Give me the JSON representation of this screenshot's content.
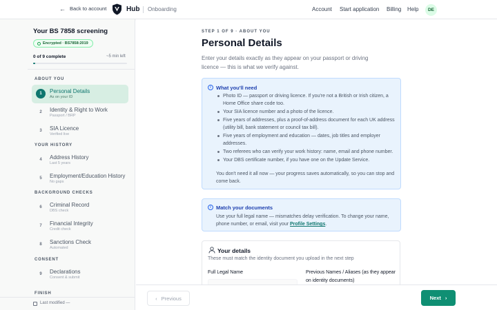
{
  "topbar": {
    "back_label": "Back to account",
    "brand": "Hub",
    "context": "Onboarding",
    "nav": [
      "Account",
      "Start application",
      "Billing",
      "Help"
    ],
    "avatar_initials": "DE"
  },
  "sidebar": {
    "title": "Your BS 7858 screening",
    "badge": "Encrypted · BS7858:2019",
    "progress_label": "0 of 9 complete",
    "progress_fraction": 0.02,
    "time_left": "~5 min left",
    "sections": [
      {
        "heading": "ABOUT YOU",
        "steps": [
          {
            "num": "1",
            "name": "Personal Details",
            "sub": "As on your ID",
            "active": true
          },
          {
            "num": "2",
            "name": "Identity & Right to Work",
            "sub": "Passport / BRP"
          },
          {
            "num": "3",
            "name": "SIA Licence",
            "sub": "Verified live"
          }
        ]
      },
      {
        "heading": "YOUR HISTORY",
        "steps": [
          {
            "num": "4",
            "name": "Address History",
            "sub": "Last 5 years"
          },
          {
            "num": "5",
            "name": "Employment/Education History",
            "sub": "No gaps"
          }
        ]
      },
      {
        "heading": "BACKGROUND CHECKS",
        "steps": [
          {
            "num": "6",
            "name": "Criminal Record",
            "sub": "DBS check"
          },
          {
            "num": "7",
            "name": "Financial Integrity",
            "sub": "Credit check"
          },
          {
            "num": "8",
            "name": "Sanctions Check",
            "sub": "Automated"
          }
        ]
      },
      {
        "heading": "CONSENT",
        "steps": [
          {
            "num": "9",
            "name": "Declarations",
            "sub": "Consent & submit"
          }
        ]
      },
      {
        "heading": "FINISH",
        "steps": []
      }
    ],
    "footer": "Last modified —"
  },
  "main": {
    "eyebrow": "STEP 1 OF 9 · ABOUT YOU",
    "title": "Personal Details",
    "intro": "Enter your details exactly as they appear on your passport or driving licence — this is what we verify against.",
    "need_card": {
      "title": "What you'll need",
      "items": [
        "Photo ID — passport or driving licence. If you're not a British or Irish citizen, a Home Office share code too.",
        "Your SIA licence number and a photo of the licence.",
        "Five years of addresses, plus a proof-of-address document for each UK address (utility bill, bank statement or council tax bill).",
        "Five years of employment and education — dates, job titles and employer addresses.",
        "Two referees who can verify your work history: name, email and phone number.",
        "Your DBS certificate number, if you have one on the Update Service."
      ],
      "footer": "You don't need it all now — your progress saves automatically, so you can stop and come back."
    },
    "match_card": {
      "title": "Match your documents",
      "text": "Use your full legal name — mismatches delay verification. To change your name, phone number, or email, visit your ",
      "link": "Profile Settings",
      "text_end": "."
    },
    "details": {
      "title": "Your details",
      "subtitle": "These must match the identity document you upload in the next step",
      "field1_label": "Full Legal Name",
      "field2_label": "Previous Names / Aliases (as they appear on identity documents)"
    },
    "actions": {
      "previous": "Previous",
      "next": "Next"
    }
  }
}
